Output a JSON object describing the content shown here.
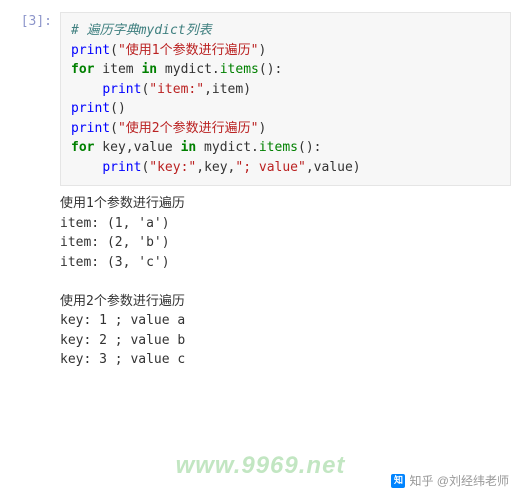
{
  "cell": {
    "prompt": "[3]:",
    "code": {
      "comment": "# 遍历字典mydict列表",
      "l2": {
        "print": "print",
        "str": "\"使用1个参数进行遍历\""
      },
      "l3": {
        "for": "for",
        "var": " item ",
        "in": "in",
        "obj": " mydict.",
        "meth": "items",
        "post": "():"
      },
      "l4": {
        "indent": "    ",
        "print": "print",
        "str": "\"item:\"",
        "rest": ",item)"
      },
      "l5": {
        "print": "print",
        "rest": "()"
      },
      "l6": {
        "print": "print",
        "str": "\"使用2个参数进行遍历\""
      },
      "l7": {
        "for": "for",
        "var": " key,value ",
        "in": "in",
        "obj": " mydict.",
        "meth": "items",
        "post": "():"
      },
      "l8": {
        "indent": "    ",
        "print": "print",
        "str1": "\"key:\"",
        "mid": ",key,",
        "str2": "\"; value\"",
        "rest": ",value)"
      }
    },
    "output": "使用1个参数进行遍历\nitem: (1, 'a')\nitem: (2, 'b')\nitem: (3, 'c')\n\n使用2个参数进行遍历\nkey: 1 ; value a\nkey: 2 ; value b\nkey: 3 ; value c"
  },
  "watermark": "www.9969.net",
  "attribution": {
    "platform_glyph": "知",
    "text": "知乎 @刘经纬老师"
  }
}
